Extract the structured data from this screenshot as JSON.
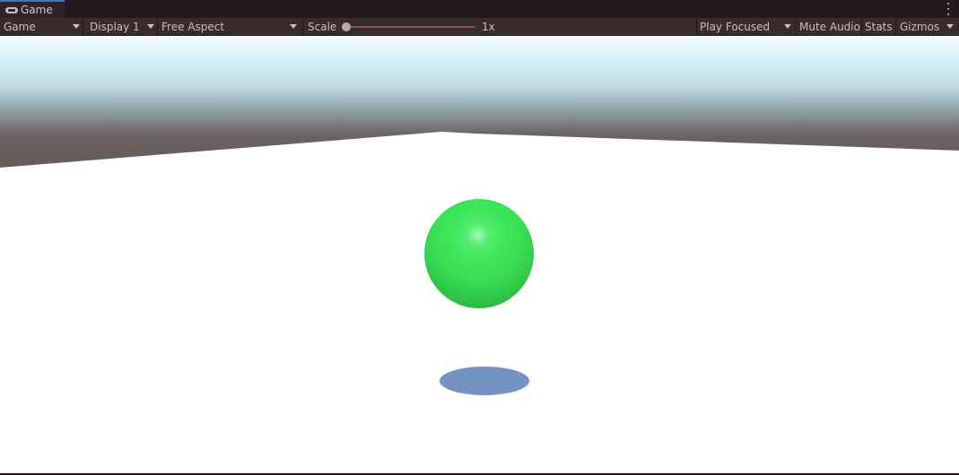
{
  "tab": {
    "title": "Game",
    "icon": "gamepad-icon"
  },
  "toolbar": {
    "view_mode": "Game",
    "display": "Display 1",
    "aspect": "Free Aspect",
    "scale_label": "Scale",
    "scale_value": "1x",
    "play_mode": "Play Focused",
    "mute_audio": "Mute Audio",
    "stats": "Stats",
    "gizmos": "Gizmos"
  },
  "scene": {
    "sky_color": "#d6f4f8",
    "horizon_color": "#615656",
    "ground_color": "#ffffff",
    "ball_color": "#3ee85a",
    "shadow_color": "#7593c2"
  }
}
